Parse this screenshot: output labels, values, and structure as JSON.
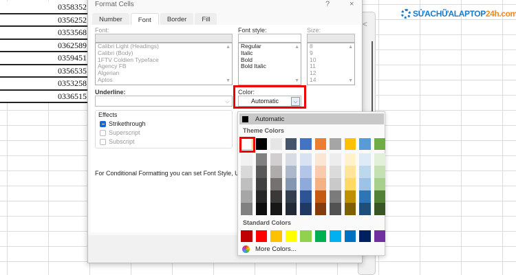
{
  "sheet": {
    "values": [
      "0358352",
      "0356252",
      "0353568",
      "0362589",
      "0359451",
      "0356535",
      "0353258",
      "0336515"
    ]
  },
  "logo": {
    "main": "SỬACHỮALAPTOP",
    "accent": "24h.com"
  },
  "side_panel": {
    "chevron": "<"
  },
  "dialog": {
    "title": "Format Cells",
    "help": "?",
    "close": "×",
    "tabs": [
      "Number",
      "Font",
      "Border",
      "Fill"
    ],
    "active_tab": "Font",
    "font_label": "Font:",
    "font_value": "",
    "fonts": [
      "Calibri Light (Headings)",
      "Calibri (Body)",
      "1FTV Coldien Typeface",
      "Agency FB",
      "Algerian",
      "Aptos"
    ],
    "style_label": "Font style:",
    "style_value": "",
    "styles": [
      "Regular",
      "Italic",
      "Bold",
      "Bold Italic"
    ],
    "size_label": "Size:",
    "size_value": "",
    "sizes": [
      "8",
      "9",
      "10",
      "11",
      "12",
      "14"
    ],
    "underline_label": "Underline:",
    "underline_value": "",
    "color_label": "Color:",
    "color_value": "Automatic",
    "effects_label": "Effects",
    "effects": [
      {
        "label": "Strikethrough",
        "checked": true
      },
      {
        "label": "Superscript",
        "checked": false
      },
      {
        "label": "Subscript",
        "checked": false
      }
    ],
    "note": "For Conditional Formatting you can set Font Style, Un"
  },
  "color_picker": {
    "automatic": "Automatic",
    "theme_label": "Theme Colors",
    "standard_label": "Standard Colors",
    "more": "More Colors...",
    "theme": [
      "#ffffff",
      "#000000",
      "#e7e6e6",
      "#44546a",
      "#4472c4",
      "#ed7d31",
      "#a5a5a5",
      "#ffc000",
      "#5b9bd5",
      "#70ad47"
    ],
    "shades": [
      [
        "#f2f2f2",
        "#d9d9d9",
        "#bfbfbf",
        "#a6a6a6",
        "#808080"
      ],
      [
        "#808080",
        "#595959",
        "#404040",
        "#262626",
        "#0d0d0d"
      ],
      [
        "#d0cece",
        "#aeabab",
        "#767171",
        "#3b3838",
        "#181717"
      ],
      [
        "#d6dce4",
        "#adb9ca",
        "#8497b0",
        "#333f4f",
        "#222a35"
      ],
      [
        "#d9e2f3",
        "#b4c6e7",
        "#8eaadb",
        "#2f5496",
        "#1f3864"
      ],
      [
        "#fbe5d5",
        "#f7cbac",
        "#f4b183",
        "#c55a11",
        "#843c0c"
      ],
      [
        "#ededed",
        "#dbdbdb",
        "#c9c9c9",
        "#7b7b7b",
        "#525252"
      ],
      [
        "#fff2cc",
        "#fee599",
        "#ffd965",
        "#bf9000",
        "#7f6000"
      ],
      [
        "#deebf6",
        "#bdd7ee",
        "#9cc3e5",
        "#2e75b5",
        "#1f4e79"
      ],
      [
        "#e2efd9",
        "#c5e0b3",
        "#a8d08d",
        "#538135",
        "#375623"
      ]
    ],
    "standard": [
      "#c00000",
      "#ff0000",
      "#ffc000",
      "#ffff00",
      "#92d050",
      "#00b050",
      "#00b0f0",
      "#0070c0",
      "#002060",
      "#7030a0"
    ]
  }
}
